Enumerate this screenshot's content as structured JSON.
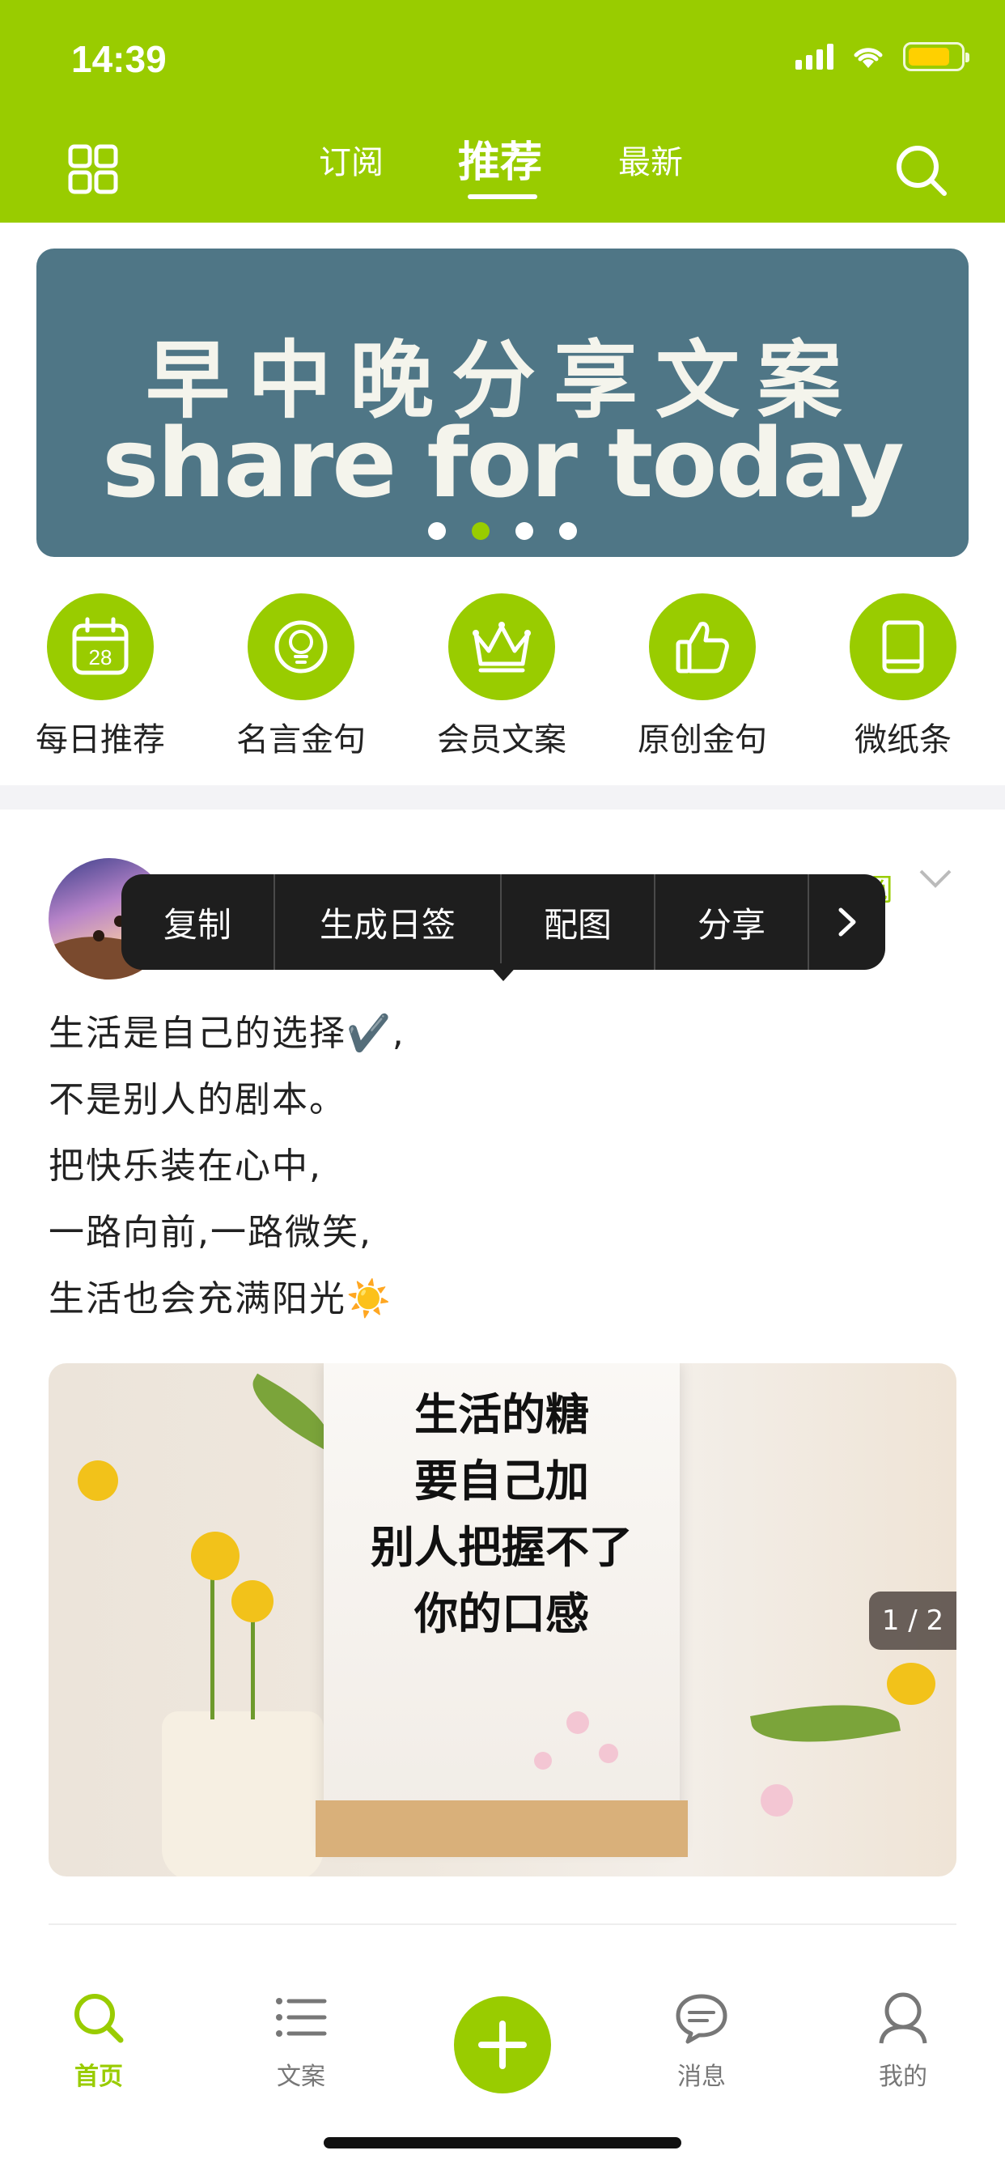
{
  "status": {
    "time": "14:39"
  },
  "header": {
    "tabs": [
      {
        "label": "订阅"
      },
      {
        "label": "推荐"
      },
      {
        "label": "最新"
      }
    ],
    "active_tab": "推荐",
    "accent_color": "#99cc00"
  },
  "banner": {
    "title": "早中晚分享文案",
    "subtitle": "share for today",
    "pages": 4,
    "active_page": 2
  },
  "categories": [
    {
      "label": "每日推荐",
      "icon": "calendar-icon",
      "badge": "28"
    },
    {
      "label": "名言金句",
      "icon": "lightbulb-icon"
    },
    {
      "label": "会员文案",
      "icon": "crown-icon"
    },
    {
      "label": "原创金句",
      "icon": "thumbs-up-icon"
    },
    {
      "label": "微纸条",
      "icon": "book-icon"
    }
  ],
  "post": {
    "subscribe_label": "订阅",
    "lines": [
      "生活是自己的选择✔️,",
      "不是别人的剧本。",
      "把快乐装在心中,",
      "一路向前,一路微笑,",
      "生活也会充满阳光☀️"
    ],
    "image_text": [
      "生活的糖",
      "要自己加",
      "别人把握不了",
      "你的口感"
    ],
    "image_counter": "1 / 2"
  },
  "context_menu": {
    "items": [
      "复制",
      "生成日签",
      "配图",
      "分享"
    ],
    "more_icon": "chevron-right-icon"
  },
  "bottom_nav": {
    "items": [
      {
        "label": "首页",
        "icon": "search-icon",
        "active": true
      },
      {
        "label": "文案",
        "icon": "list-icon",
        "active": false
      },
      {
        "label": "消息",
        "icon": "message-icon",
        "active": false
      },
      {
        "label": "我的",
        "icon": "profile-icon",
        "active": false
      }
    ],
    "add_icon": "plus-icon"
  }
}
